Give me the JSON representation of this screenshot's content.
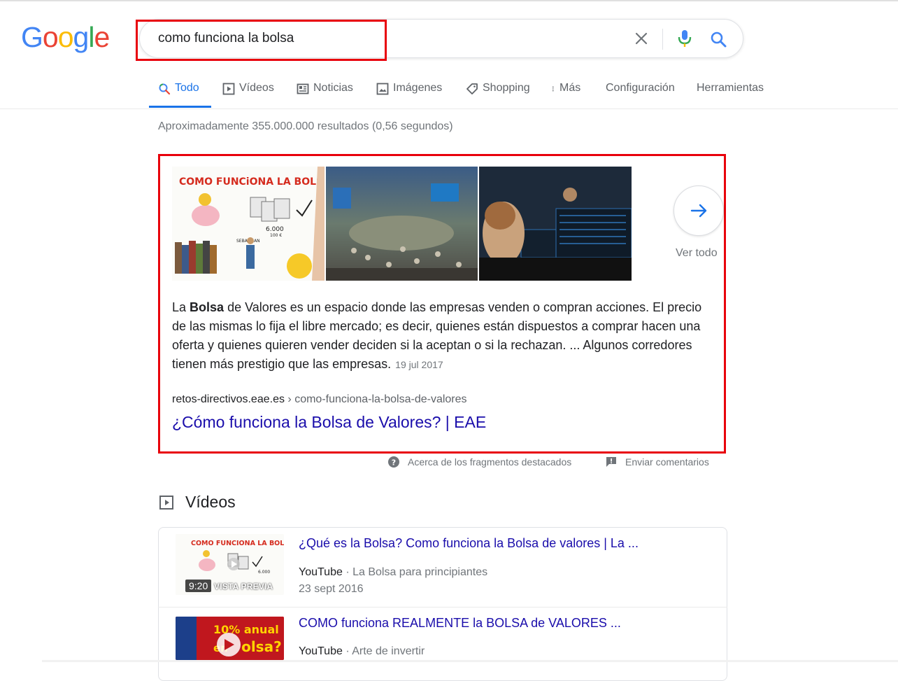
{
  "logo": {
    "letters": [
      "G",
      "o",
      "o",
      "g",
      "l",
      "e"
    ],
    "colors": [
      "#4285F4",
      "#EA4335",
      "#FBBC05",
      "#4285F4",
      "#34A853",
      "#EA4335"
    ]
  },
  "search": {
    "query": "como funciona la bolsa",
    "placeholder": "",
    "clear_icon": "close-icon",
    "mic_icon": "mic-icon",
    "search_icon": "search-icon"
  },
  "tabs": [
    {
      "label": "Todo",
      "icon": "search-icon",
      "active": true
    },
    {
      "label": "Vídeos",
      "icon": "play-box-icon"
    },
    {
      "label": "Noticias",
      "icon": "news-icon"
    },
    {
      "label": "Imágenes",
      "icon": "image-icon"
    },
    {
      "label": "Shopping",
      "icon": "tag-icon"
    },
    {
      "label": "Más",
      "icon": "more-vert-icon"
    },
    {
      "label": "Configuración"
    },
    {
      "label": "Herramientas"
    }
  ],
  "stats": "Aproximadamente 355.000.000 resultados (0,56 segundos)",
  "snippet": {
    "images": [
      {
        "title": "COMO FUNCiONA LA BOLSA",
        "label_a": "6.000",
        "label_b": "100 €",
        "label_c": "SEBASTIAN"
      },
      {
        "alt": "stock exchange floor"
      },
      {
        "alt": "trader at screens"
      }
    ],
    "see_all": "Ver todo",
    "text_pre": "La ",
    "text_bold": "Bolsa",
    "text_post": " de Valores es un espacio donde las empresas venden o compran acciones. El precio de las mismas lo fija el libre mercado; es decir, quienes están dispuestos a comprar hacen una oferta y quienes quieren vender deciden si la aceptan o si la rechazan. ... Algunos corredores tienen más prestigio que las empresas.",
    "date": "19 jul 2017",
    "cite_domain": "retos-directivos.eae.es",
    "cite_path": " › como-funciona-la-bolsa-de-valores",
    "link_title": "¿Cómo funciona la Bolsa de Valores? | EAE"
  },
  "feedback": {
    "about": "Acerca de los fragmentos destacados",
    "send": "Enviar comentarios"
  },
  "videos": {
    "heading": "Vídeos",
    "items": [
      {
        "title": "¿Qué es la Bolsa? Como funciona la Bolsa de valores | La ...",
        "source": "YouTube",
        "channel": " · La Bolsa para principiantes",
        "date": "23 sept 2016",
        "duration": "9:20",
        "overlay": "VISTA PREVIA",
        "thumb_title": "COMO FUNCIONA LA BOLSA",
        "thumb_label": "6.000"
      },
      {
        "title": "COMO funciona REALMENTE la BOLSA de VALORES ...",
        "source": "YouTube",
        "channel": " · Arte de invertir",
        "thumb_line1": "10% anual",
        "thumb_line2a": "en ",
        "thumb_line2b": "olsa?"
      }
    ]
  },
  "colors": {
    "accent": "#1a73e8",
    "link": "#1a0dab",
    "highlight": "#e8000b"
  }
}
